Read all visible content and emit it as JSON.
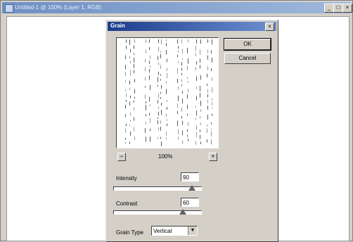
{
  "window": {
    "title": "Untitled-1 @ 100% (Layer 1, RGB)"
  },
  "dialog": {
    "title": "Grain",
    "ok_label": "OK",
    "cancel_label": "Cancel",
    "zoom_level": "100%",
    "intensity": {
      "label": "Intensity",
      "value": "90",
      "slider_fraction": 0.9
    },
    "contrast": {
      "label": "Contrast",
      "value": "60",
      "slider_fraction": 0.8
    },
    "grain_type": {
      "label": "Grain Type",
      "selected": "Vertical"
    }
  }
}
